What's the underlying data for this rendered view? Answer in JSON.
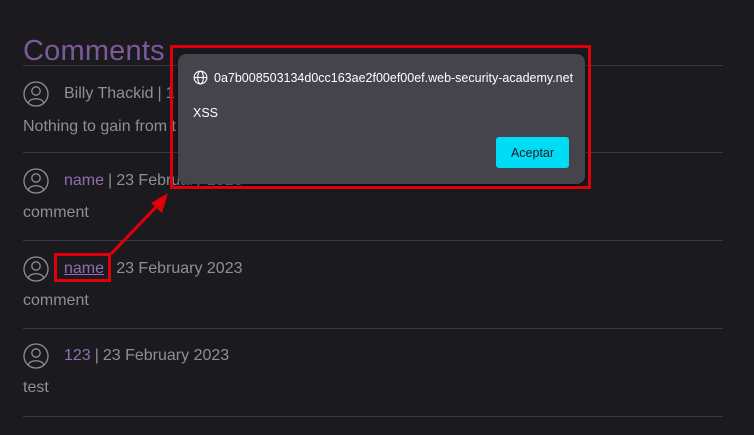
{
  "page": {
    "heading": "Comments"
  },
  "comments": [
    {
      "author": "Billy Thackid",
      "separator": "|",
      "date": "1",
      "body": "Nothing to gain from t"
    },
    {
      "author": "name",
      "separator": "|",
      "date": "23 February 2023",
      "body": "comment"
    },
    {
      "author": "name",
      "separator": "|",
      "date": "23 February 2023",
      "body": "comment"
    },
    {
      "author": "123",
      "separator": "|",
      "date": "23 February 2023",
      "body": "test"
    }
  ],
  "dialog": {
    "origin": "0a7b008503134d0cc163ae2f00ef00ef.web-security-academy.net",
    "message": "XSS",
    "button_label": "Aceptar"
  },
  "colors": {
    "background": "#1b1a1f",
    "heading": "#7b5a9a",
    "author_link": "#8f6fb0",
    "text": "#8f8f95",
    "dialog_bg": "#45444d",
    "button": "#00dcf5",
    "highlight": "#e0000a"
  }
}
